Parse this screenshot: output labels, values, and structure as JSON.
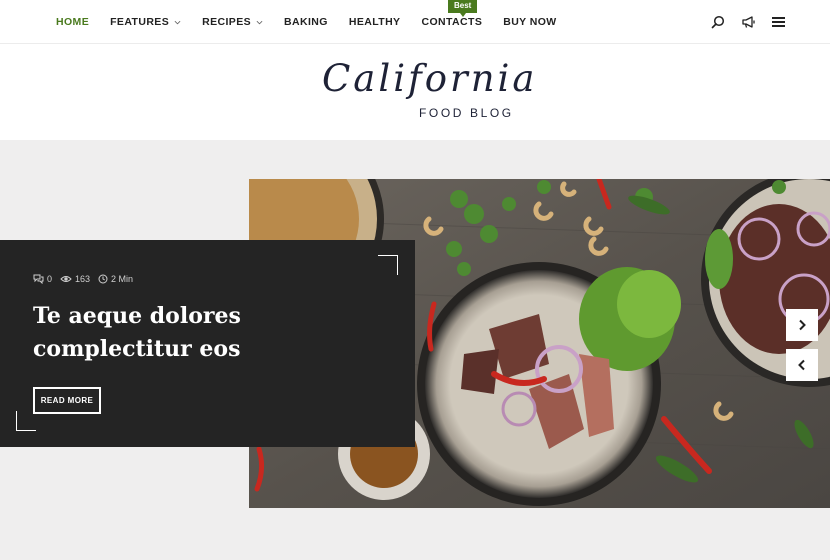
{
  "nav": {
    "items": [
      {
        "label": "Home",
        "active": true,
        "dropdown": false
      },
      {
        "label": "Features",
        "active": false,
        "dropdown": true
      },
      {
        "label": "Recipes",
        "active": false,
        "dropdown": true
      },
      {
        "label": "Baking",
        "active": false,
        "dropdown": false
      },
      {
        "label": "Healthy",
        "active": false,
        "dropdown": false
      },
      {
        "label": "Contacts",
        "active": false,
        "dropdown": false
      },
      {
        "label": "Buy Now",
        "active": false,
        "dropdown": false
      }
    ],
    "badge": "Best",
    "icons": [
      "search-icon",
      "megaphone-icon",
      "hamburger-menu-icon"
    ]
  },
  "logo": {
    "script": "California",
    "subtitle": "FOOD BLOG"
  },
  "slide": {
    "comments": "0",
    "views": "163",
    "read_time": "2 Min",
    "title": "Te aeque dolores complectitur eos",
    "button": "READ MORE",
    "image": "food-photo-grilled-steak-salad-bowls"
  },
  "slider": {
    "dot_count": 5,
    "active_dot": 2,
    "controls": [
      "chevron-right-icon",
      "chevron-left-icon"
    ]
  },
  "colors": {
    "accent": "#4a7a1e",
    "card": "#242424",
    "hero_bg": "#efeeee",
    "logo_ink": "#1e2236"
  }
}
